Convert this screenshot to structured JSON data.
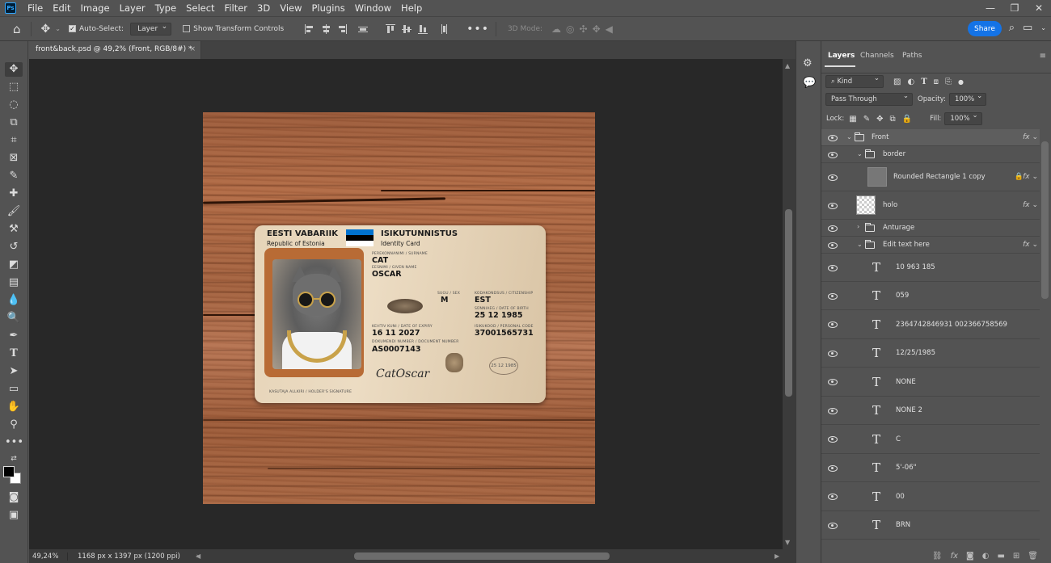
{
  "menu": [
    "File",
    "Edit",
    "Image",
    "Layer",
    "Type",
    "Select",
    "Filter",
    "3D",
    "View",
    "Plugins",
    "Window",
    "Help"
  ],
  "app_logo": "Ps",
  "options": {
    "auto_select_label": "Auto-Select:",
    "auto_select_value": "Layer",
    "transform_controls_label": "Show Transform Controls",
    "mode3d_label": "3D Mode:",
    "share_label": "Share"
  },
  "document": {
    "tab_title": "front&back.psd @ 49,2% (Front, RGB/8#) *",
    "zoom": "49,24%",
    "info": "1168 px x 1397 px (1200 ppi)"
  },
  "card": {
    "country_et": "EESTI VABARIIK",
    "country_en": "Republic of Estonia",
    "doc_et": "ISIKUTUNNISTUS",
    "doc_en": "Identity Card",
    "surname_label": "PEREKONNANIMI / SURNAME",
    "surname": "CAT",
    "given_label": "EESNIMI / GIVEN NAME",
    "given": "OSCAR",
    "sex_label": "SUGU / SEX",
    "sex": "M",
    "citizenship_label": "KODAKONDSUS / CITIZENSHIP",
    "citizenship": "EST",
    "dob_label": "SÜNNIAEG / DATE OF BIRTH",
    "dob": "25 12 1985",
    "expiry_label": "KEHTIV KUNI / DATE OF EXPIRY",
    "expiry": "16 11 2027",
    "personal_label": "ISIKUKOOD / PERSONAL CODE",
    "personal_code": "37001565731",
    "docnum_label": "DOKUMENDI NUMBER / DOCUMENT NUMBER",
    "docnum": "AS0007143",
    "signature_label": "KASUTAJA ALLKIRI / HOLDER'S SIGNATURE",
    "signature": "CatOscar",
    "stamp_number": "25 12 1985"
  },
  "panel": {
    "tabs": [
      "Layers",
      "Channels",
      "Paths"
    ],
    "kind_label": "Kind",
    "blend_mode": "Pass Through",
    "opacity_label": "Opacity:",
    "opacity_value": "100%",
    "lock_label": "Lock:",
    "fill_label": "Fill:",
    "fill_value": "100%"
  },
  "layers": [
    {
      "name": "Front",
      "kind": "group"
    },
    {
      "name": "border",
      "kind": "group"
    },
    {
      "name": "Rounded Rectangle 1 copy",
      "kind": "shape"
    },
    {
      "name": "holo",
      "kind": "pixel"
    },
    {
      "name": "Anturage",
      "kind": "group"
    },
    {
      "name": "Edit text here",
      "kind": "group"
    },
    {
      "name": "10 963 185",
      "kind": "text"
    },
    {
      "name": "059",
      "kind": "text"
    },
    {
      "name": "2364742846931 002366758569",
      "kind": "text"
    },
    {
      "name": "12/25/1985",
      "kind": "text"
    },
    {
      "name": "NONE",
      "kind": "text"
    },
    {
      "name": "NONE 2",
      "kind": "text"
    },
    {
      "name": "C",
      "kind": "text"
    },
    {
      "name": "5'-06\"",
      "kind": "text"
    },
    {
      "name": "00",
      "kind": "text"
    },
    {
      "name": "BRN",
      "kind": "text"
    }
  ],
  "colors": {
    "accent": "#1473e6",
    "flag_blue": "#0072ce",
    "flag_black": "#000000",
    "flag_white": "#ffffff"
  }
}
